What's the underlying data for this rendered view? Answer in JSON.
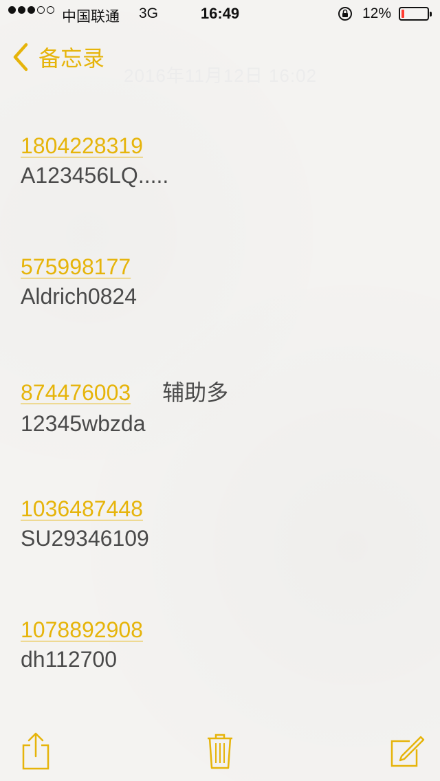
{
  "status_bar": {
    "signal_full": 3,
    "signal_total": 5,
    "carrier": "中国联通",
    "network": "3G",
    "time": "16:49",
    "battery_percent": "12%",
    "battery_level": 0.12,
    "battery_color": "#ff3b30"
  },
  "nav": {
    "back_label": "备忘录",
    "faded_date": "2016年11月12日 16:02"
  },
  "entries": [
    {
      "number": "1804228319",
      "secret": "A123456LQ.....",
      "note": ""
    },
    {
      "number": "575998177",
      "secret": "Aldrich0824",
      "note": ""
    },
    {
      "number": "874476003",
      "secret": "12345wbzda",
      "note": "辅助多"
    },
    {
      "number": "1036487448",
      "secret": "SU29346109",
      "note": ""
    },
    {
      "number": "1078892908",
      "secret": "dh112700",
      "note": ""
    }
  ],
  "toolbar": {
    "items": [
      "share-icon",
      "trash-icon",
      "compose-icon"
    ]
  },
  "colors": {
    "accent": "#e6b40a",
    "text": "#4a4a4a",
    "background": "#f4f3f1"
  }
}
